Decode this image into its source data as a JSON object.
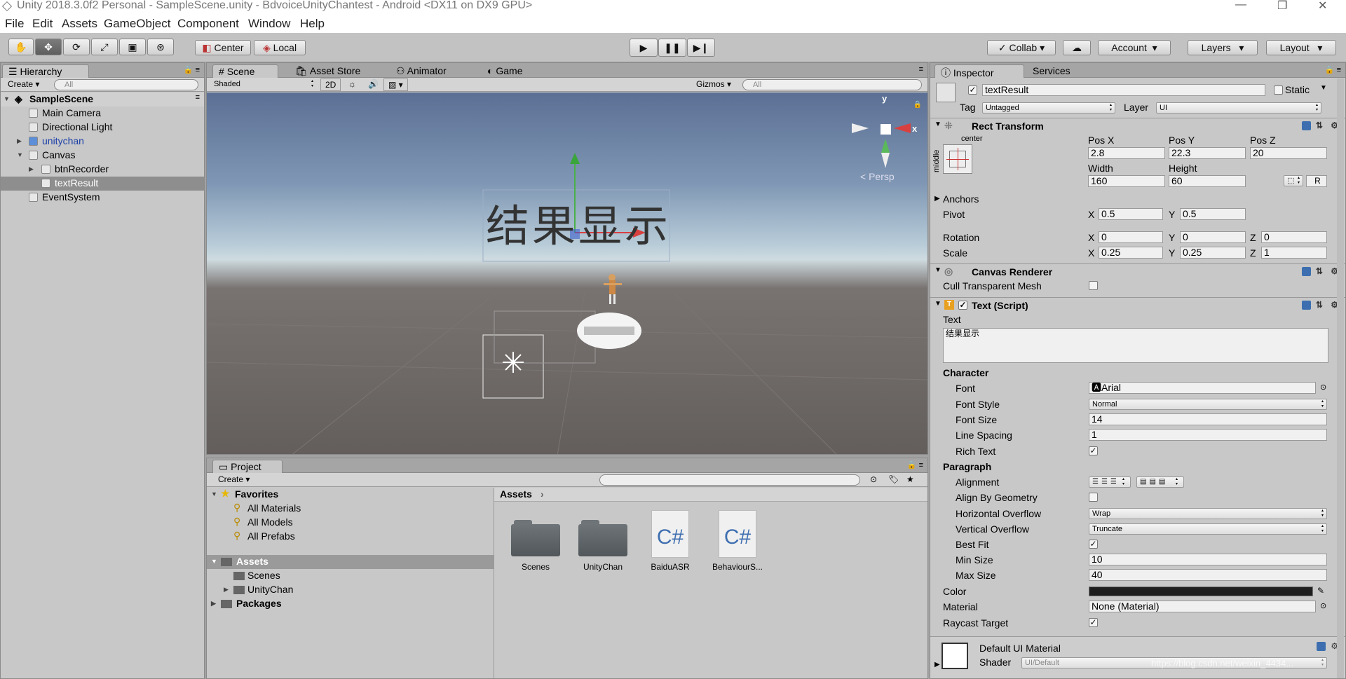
{
  "window": {
    "title": "Unity 2018.3.0f2 Personal - SampleScene.unity - BdvoiceUnityChantest - Android <DX11 on DX9 GPU>",
    "minimize": "—",
    "maximize": "❐",
    "close": "✕"
  },
  "menu": [
    "File",
    "Edit",
    "Assets",
    "GameObject",
    "Component",
    "Window",
    "Help"
  ],
  "toolbar": {
    "pivot_center": "Center",
    "pivot_local": "Local",
    "collab": "Collab",
    "account": "Account",
    "layers": "Layers",
    "layout": "Layout",
    "tool_icons": [
      "hand-icon",
      "move-icon",
      "rotate-icon",
      "scale-icon",
      "rect-icon",
      "transform-icon"
    ]
  },
  "hierarchy": {
    "tab": "Hierarchy",
    "create": "Create",
    "search_placeholder": "All",
    "scene": "SampleScene",
    "items": [
      {
        "label": "Main Camera"
      },
      {
        "label": "Directional Light"
      },
      {
        "label": "unitychan"
      },
      {
        "label": "Canvas"
      },
      {
        "label": "btnRecorder"
      },
      {
        "label": "textResult"
      },
      {
        "label": "EventSystem"
      }
    ]
  },
  "scene": {
    "tabs": [
      "Scene",
      "Asset Store",
      "Animator",
      "Game"
    ],
    "shading": "Shaded",
    "mode_2d": "2D",
    "gizmos": "Gizmos",
    "search_placeholder": "All",
    "persp": "< Persp",
    "text_object": "结果显示",
    "gizmo_x": "x",
    "gizmo_y": "y"
  },
  "project": {
    "tab": "Project",
    "create": "Create",
    "favorites": "Favorites",
    "fav_items": [
      "All Materials",
      "All Models",
      "All Prefabs"
    ],
    "assets": "Assets",
    "asset_children": [
      "Scenes",
      "UnityChan"
    ],
    "packages": "Packages",
    "breadcrumb": "Assets",
    "files": [
      {
        "name": "Scenes",
        "kind": "folder"
      },
      {
        "name": "UnityChan",
        "kind": "folder"
      },
      {
        "name": "BaiduASR",
        "kind": "cs"
      },
      {
        "name": "BehaviourS...",
        "kind": "cs"
      }
    ],
    "cs_glyph": "C#"
  },
  "inspector": {
    "tab": "Inspector",
    "services": "Services",
    "object_name": "textResult",
    "static": "Static",
    "tag_label": "Tag",
    "tag": "Untagged",
    "layer_label": "Layer",
    "layer": "UI",
    "rect": {
      "title": "Rect Transform",
      "anchor_h": "center",
      "anchor_v": "middle",
      "pos_x_l": "Pos X",
      "pos_y_l": "Pos Y",
      "pos_z_l": "Pos Z",
      "pos_x": "2.8",
      "pos_y": "22.3",
      "pos_z": "20",
      "width_l": "Width",
      "height_l": "Height",
      "width": "160",
      "height": "60",
      "r": "R",
      "anchors": "Anchors",
      "pivot": "Pivot",
      "pivot_x": "0.5",
      "pivot_y": "0.5",
      "rotation": "Rotation",
      "rot_x": "0",
      "rot_y": "0",
      "rot_z": "0",
      "scale": "Scale",
      "sc_x": "0.25",
      "sc_y": "0.25",
      "sc_z": "1",
      "x": "X",
      "y": "Y",
      "z": "Z"
    },
    "canvas_renderer": {
      "title": "Canvas Renderer",
      "cull": "Cull Transparent Mesh"
    },
    "text": {
      "title": "Text (Script)",
      "text_label": "Text",
      "text_value": "结果显示",
      "character": "Character",
      "font_l": "Font",
      "font": "Arial",
      "style_l": "Font Style",
      "style": "Normal",
      "size_l": "Font Size",
      "size": "14",
      "spacing_l": "Line Spacing",
      "spacing": "1",
      "rich_l": "Rich Text",
      "paragraph": "Paragraph",
      "align_l": "Alignment",
      "geom_l": "Align By Geometry",
      "hover_l": "Horizontal Overflow",
      "hover": "Wrap",
      "vover_l": "Vertical Overflow",
      "vover": "Truncate",
      "best_l": "Best Fit",
      "min_l": "Min Size",
      "min": "10",
      "max_l": "Max Size",
      "max": "40",
      "color_l": "Color",
      "color": "#1e1e1e",
      "material_l": "Material",
      "material": "None (Material)",
      "raycast_l": "Raycast Target"
    },
    "material": {
      "title": "Default UI Material",
      "shader_l": "Shader",
      "shader": "UI/Default"
    }
  },
  "watermark": "https://blog.csdn.net/weixin_4434..."
}
